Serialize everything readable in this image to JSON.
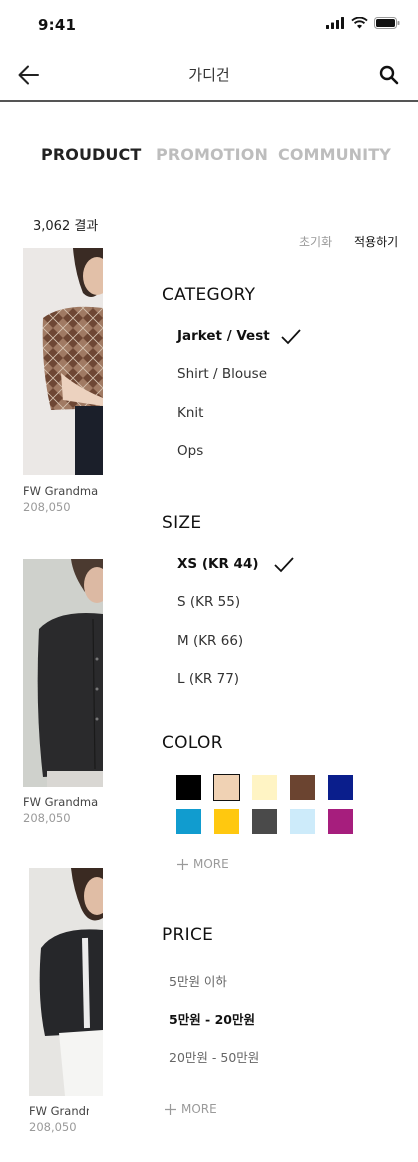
{
  "status_bar": {
    "time": "9:41"
  },
  "nav": {
    "title": "가디건"
  },
  "tabs": [
    {
      "label": "PROUDUCT",
      "active": true
    },
    {
      "label": "PROMOTION",
      "active": false
    },
    {
      "label": "COMMUNITY",
      "active": false
    }
  ],
  "results": {
    "count": "3,062 결과"
  },
  "filter_actions": {
    "reset": "초기화",
    "apply": "적용하기"
  },
  "products": [
    {
      "name": "FW Grandma",
      "price": "208,050"
    },
    {
      "name": "FW Grandma",
      "price": "208,050"
    },
    {
      "name": "FW Grandma",
      "price": "208,050"
    }
  ],
  "category": {
    "title": "CATEGORY",
    "options": [
      {
        "label": "Jarket / Vest",
        "selected": true
      },
      {
        "label": "Shirt / Blouse",
        "selected": false
      },
      {
        "label": "Knit",
        "selected": false
      },
      {
        "label": "Ops",
        "selected": false
      }
    ]
  },
  "size": {
    "title": "SIZE",
    "options": [
      {
        "label": "XS (KR 44)",
        "selected": true
      },
      {
        "label": "S (KR 55)",
        "selected": false
      },
      {
        "label": "M (KR 66)",
        "selected": false
      },
      {
        "label": "L (KR 77)",
        "selected": false
      }
    ]
  },
  "color": {
    "title": "COLOR",
    "swatches": [
      {
        "hex": "#000000",
        "selected": false
      },
      {
        "hex": "#F0D2B4",
        "selected": true
      },
      {
        "hex": "#FFF4C4",
        "selected": false
      },
      {
        "hex": "#6B4430",
        "selected": false
      },
      {
        "hex": "#0A1E8C",
        "selected": false
      },
      {
        "hex": "#119CCF",
        "selected": false
      },
      {
        "hex": "#FFC80F",
        "selected": false
      },
      {
        "hex": "#4A4A4A",
        "selected": false
      },
      {
        "hex": "#CDEBFA",
        "selected": false
      },
      {
        "hex": "#A61E7D",
        "selected": false
      }
    ],
    "more_label": "MORE"
  },
  "price": {
    "title": "PRICE",
    "options": [
      {
        "label": "5만원 이하",
        "selected": false
      },
      {
        "label": "5만원 - 20만원",
        "selected": true
      },
      {
        "label": "20만원 - 50만원",
        "selected": false
      }
    ],
    "more_label": "MORE"
  }
}
